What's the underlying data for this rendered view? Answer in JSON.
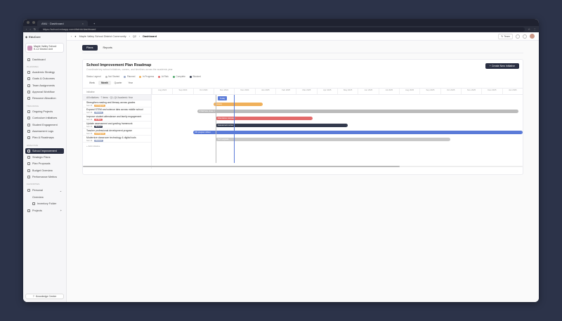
{
  "browser": {
    "tab_title": "ANU · Dashboard",
    "url": "https://school.eduapp.com/district/dashboard"
  },
  "sidebar": {
    "app_name": "EduCore",
    "org_line1": "Maple Valley School",
    "org_line2": "K-12 District Unit",
    "dashboard": "Dashboard",
    "section_1": "PLANNING",
    "group_1": [
      "Academic Strategy",
      "Goals & Outcomes",
      "Team Assignments",
      "Approval Workflow",
      "Resource Allocation"
    ],
    "section_2": "TRACKING",
    "group_2": [
      "Ongoing Projects",
      "Curriculum Initiatives",
      "Student Engagement",
      "Assessment Logs",
      "Plan & Roadmaps"
    ],
    "section_3": "ANALYSIS",
    "group_3": [
      "School Improvement",
      "Strategic Plans",
      "Plan Proposals",
      "Budget Overview",
      "Performance Metrics"
    ],
    "section_4": "FAVORITES",
    "fav_1": "Personal",
    "fav_1a": "Overview",
    "fav_1b": "Inventory Folder",
    "fav_2": "Projects",
    "help": "Knowledge Center"
  },
  "topbar": {
    "crumb_1": "Maple Valley School District Community",
    "crumb_2": "Q2",
    "crumb_3": "Dashboard",
    "team_btn": "Team"
  },
  "tabs": [
    "Plans",
    "Reports"
  ],
  "card": {
    "title": "School Improvement Plan Roadmap",
    "subtitle": "Coordinate key school initiatives, owners, and timelines across the academic year",
    "create": "+ Create New Initiative"
  },
  "legend": [
    "Status Legend",
    "Not Started",
    "Planned",
    "In Progress",
    "At Risk",
    "Complete",
    "Blocked"
  ],
  "legend_colors": [
    "#ffffff",
    "#bbbbbb",
    "#9aa8c8",
    "#f0b05a",
    "#e36a6a",
    "#4fa86b",
    "#333a4d"
  ],
  "zoom": [
    "Week",
    "Month",
    "Quarter",
    "Year"
  ],
  "gantt": {
    "header": "Initiative",
    "group": "All Initiatives · 7 items · Q1–Q4 Academic Year",
    "rows": [
      {
        "name": "Strengthen reading and literacy across grades",
        "owner": "Sam M.",
        "badge": "In Progress"
      },
      {
        "name": "Expand STEM and science labs across middle school",
        "owner": "Sam M.",
        "badge": "Planned"
      },
      {
        "name": "Improve student attendance and family engagement",
        "owner": "Sam M.",
        "badge": "At Risk"
      },
      {
        "name": "Update assessment and grading framework",
        "owner": "Sam M.",
        "badge": "Blocked"
      },
      {
        "name": "Teacher professional development program",
        "owner": "Sam M.",
        "badge": "In Progress"
      },
      {
        "name": "Modernize classroom technology & digital tools",
        "owner": "Sam M.",
        "badge": "Planned"
      }
    ],
    "add": "+ Add initiative",
    "months": [
      "Aug 2024",
      "Sep 2024",
      "Oct 2024",
      "Nov 2024",
      "Dec 2024",
      "Jan 2025",
      "Feb 2025",
      "Mar 2025",
      "Apr 2025",
      "May 2025",
      "Jun 2025",
      "Jul 2025",
      "Aug 2025",
      "Sep 2025",
      "Oct 2025",
      "Nov 2025",
      "Dec 2025",
      "Jan 2026"
    ],
    "today_label": "Today",
    "bar_labels": [
      "Literacy",
      "STEM labs phase 1",
      "Attendance campaign",
      "Assessment review",
      "PD program rollout",
      "Tech upgrade"
    ]
  }
}
